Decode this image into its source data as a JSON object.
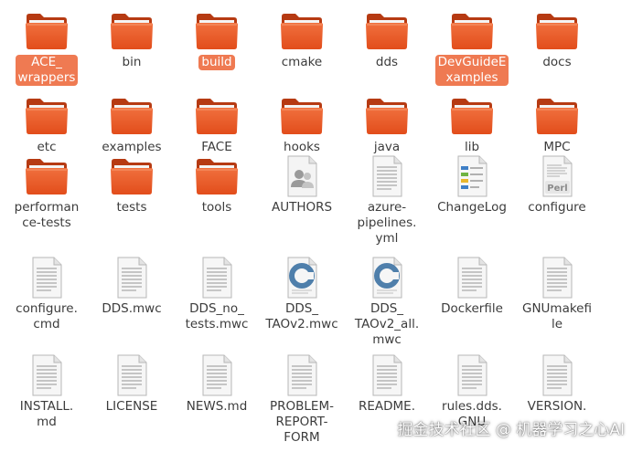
{
  "colors": {
    "folder_front_top": "#f0703e",
    "folder_front_bottom": "#e24d1b",
    "folder_back": "#b63a12",
    "folder_paper": "#f4f4f4",
    "selected_bg": "#ef7a52"
  },
  "files": [
    {
      "label": "ACE_\nwrappers",
      "icon": "folder-icon",
      "selected": true
    },
    {
      "label": "bin",
      "icon": "folder-icon",
      "selected": false
    },
    {
      "label": "build",
      "icon": "folder-icon",
      "selected": true
    },
    {
      "label": "cmake",
      "icon": "folder-icon",
      "selected": false
    },
    {
      "label": "dds",
      "icon": "folder-icon",
      "selected": false
    },
    {
      "label": "DevGuideE\nxamples",
      "icon": "folder-icon",
      "selected": true
    },
    {
      "label": "docs",
      "icon": "folder-icon",
      "selected": false
    },
    {
      "label": "etc",
      "icon": "folder-icon",
      "selected": false
    },
    {
      "label": "examples",
      "icon": "folder-icon",
      "selected": false
    },
    {
      "label": "FACE",
      "icon": "folder-icon",
      "selected": false
    },
    {
      "label": "hooks",
      "icon": "folder-icon",
      "selected": false
    },
    {
      "label": "java",
      "icon": "folder-icon",
      "selected": false
    },
    {
      "label": "lib",
      "icon": "folder-icon",
      "selected": false
    },
    {
      "label": "MPC",
      "icon": "folder-icon",
      "selected": false
    },
    {
      "label": "performan\nce-tests",
      "icon": "folder-icon",
      "selected": false
    },
    {
      "label": "tests",
      "icon": "folder-icon",
      "selected": false
    },
    {
      "label": "tools",
      "icon": "folder-icon",
      "selected": false
    },
    {
      "label": "AUTHORS",
      "icon": "contact-document-icon",
      "selected": false
    },
    {
      "label": "azure-\npipelines.\nyml",
      "icon": "text-document-icon",
      "selected": false
    },
    {
      "label": "ChangeLog",
      "icon": "changelog-document-icon",
      "selected": false
    },
    {
      "label": "configure",
      "icon": "perl-script-icon",
      "selected": false
    },
    {
      "label": "configure.\ncmd",
      "icon": "text-document-icon",
      "selected": false
    },
    {
      "label": "DDS.mwc",
      "icon": "text-document-icon",
      "selected": false
    },
    {
      "label": "DDS_no_\ntests.mwc",
      "icon": "text-document-icon",
      "selected": false
    },
    {
      "label": "DDS_\nTAOv2.mwc",
      "icon": "c-source-icon",
      "selected": false
    },
    {
      "label": "DDS_\nTAOv2_all.\nmwc",
      "icon": "c-source-icon",
      "selected": false
    },
    {
      "label": "Dockerfile",
      "icon": "text-document-icon",
      "selected": false
    },
    {
      "label": "GNUmakefi\nle",
      "icon": "text-document-icon",
      "selected": false
    },
    {
      "label": "INSTALL.\nmd",
      "icon": "text-document-icon",
      "selected": false
    },
    {
      "label": "LICENSE",
      "icon": "text-document-icon",
      "selected": false
    },
    {
      "label": "NEWS.md",
      "icon": "text-document-icon",
      "selected": false
    },
    {
      "label": "PROBLEM-\nREPORT-\nFORM",
      "icon": "text-document-icon",
      "selected": false
    },
    {
      "label": "README.",
      "icon": "text-document-icon",
      "selected": false
    },
    {
      "label": "rules.dds.\nGNU",
      "icon": "text-document-icon",
      "selected": false
    },
    {
      "label": "VERSION.",
      "icon": "text-document-icon",
      "selected": false
    }
  ],
  "watermark": "掘金技术社区 @ 机器学习之心AI"
}
